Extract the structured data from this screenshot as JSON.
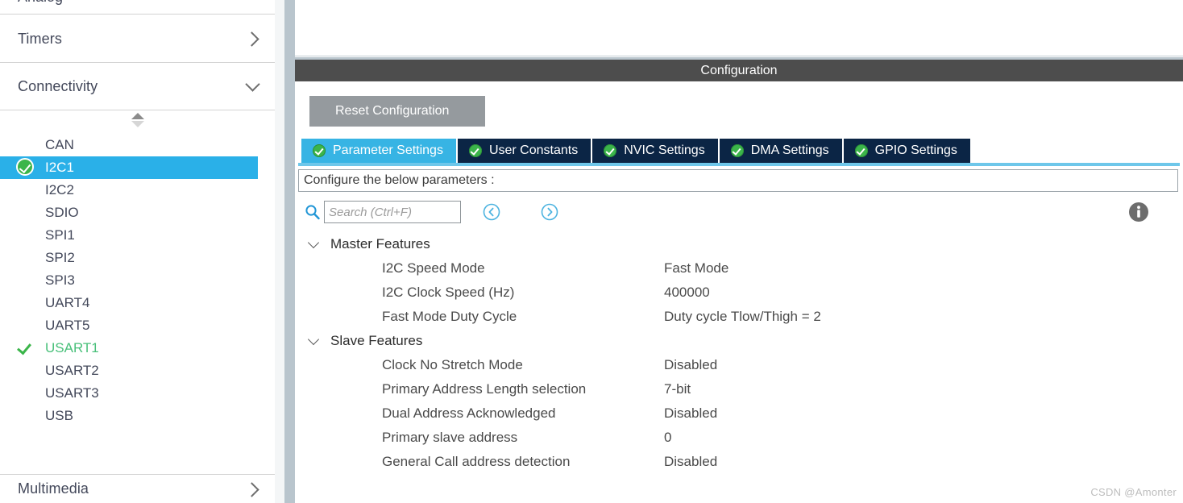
{
  "sidebar": {
    "partial_top_item": "",
    "categories": [
      {
        "label": "Timers",
        "chevron": "chevron-right-icon",
        "expanded": false
      },
      {
        "label": "Connectivity",
        "chevron": "chevron-down-icon",
        "expanded": true
      },
      {
        "label": "Multimedia",
        "chevron": "chevron-right-icon",
        "expanded": false
      }
    ],
    "spinner": "sort-spinner-icon",
    "peripherals": [
      {
        "label": "CAN",
        "status": "none",
        "selected": false
      },
      {
        "label": "I2C1",
        "status": "configured-badge",
        "selected": true
      },
      {
        "label": "I2C2",
        "status": "none",
        "selected": false
      },
      {
        "label": "SDIO",
        "status": "none",
        "selected": false
      },
      {
        "label": "SPI1",
        "status": "none",
        "selected": false
      },
      {
        "label": "SPI2",
        "status": "none",
        "selected": false
      },
      {
        "label": "SPI3",
        "status": "none",
        "selected": false
      },
      {
        "label": "UART4",
        "status": "none",
        "selected": false
      },
      {
        "label": "UART5",
        "status": "none",
        "selected": false
      },
      {
        "label": "USART1",
        "status": "check-mark",
        "selected": false
      },
      {
        "label": "USART2",
        "status": "none",
        "selected": false
      },
      {
        "label": "USART3",
        "status": "none",
        "selected": false
      },
      {
        "label": "USB",
        "status": "none",
        "selected": false
      }
    ]
  },
  "panel": {
    "header_title": "Configuration",
    "reset_button": "Reset Configuration",
    "tabs": [
      {
        "label": "Parameter Settings",
        "icon": "green-check-icon",
        "active": true
      },
      {
        "label": "User Constants",
        "icon": "green-check-icon",
        "active": false
      },
      {
        "label": "NVIC Settings",
        "icon": "green-check-icon",
        "active": false
      },
      {
        "label": "DMA Settings",
        "icon": "green-check-icon",
        "active": false
      },
      {
        "label": "GPIO Settings",
        "icon": "green-check-icon",
        "active": false
      }
    ],
    "configure_label": "Configure the below parameters :",
    "search": {
      "icon": "search-icon",
      "placeholder": "Search (Ctrl+F)",
      "value": "",
      "prev_icon": "chevron-left-circle-icon",
      "next_icon": "chevron-right-circle-icon"
    },
    "info_icon": "info-icon",
    "tree": [
      {
        "group": "Master Features",
        "expanded": true,
        "rows": [
          {
            "name": "I2C Speed Mode",
            "value": "Fast Mode"
          },
          {
            "name": "I2C Clock Speed (Hz)",
            "value": "400000"
          },
          {
            "name": "Fast Mode Duty Cycle",
            "value": "Duty cycle Tlow/Thigh = 2"
          }
        ]
      },
      {
        "group": "Slave Features",
        "expanded": true,
        "rows": [
          {
            "name": "Clock No Stretch Mode",
            "value": "Disabled"
          },
          {
            "name": "Primary Address Length selection",
            "value": "7-bit"
          },
          {
            "name": "Dual Address Acknowledged",
            "value": "Disabled"
          },
          {
            "name": "Primary slave address",
            "value": "0"
          },
          {
            "name": "General Call address detection",
            "value": "Disabled"
          }
        ]
      }
    ]
  },
  "watermark": "CSDN @Amonter",
  "colors": {
    "selection_blue": "#2ab0e8",
    "tab_active": "#37b4e4",
    "tab_inactive": "#0b2545",
    "header_gray": "#4d4d4d",
    "status_green": "#3bb54a",
    "divider": "#b9c5cd",
    "sidebar_text": "#43485a"
  }
}
